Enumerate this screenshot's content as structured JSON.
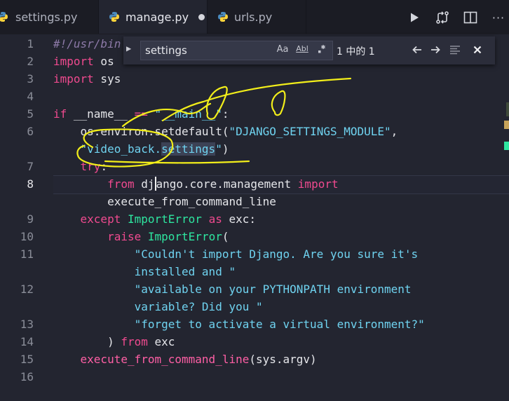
{
  "tabs": [
    {
      "label": "settings.py",
      "active": false,
      "dirty": false
    },
    {
      "label": "manage.py",
      "active": true,
      "dirty": true
    },
    {
      "label": "urls.py",
      "active": false,
      "dirty": false
    }
  ],
  "toolbar": {
    "run_icon": "play-icon",
    "compare_icon": "git-compare-icon",
    "split_icon": "split-editor-icon",
    "more_icon": "more-icon",
    "more_label": "···"
  },
  "find": {
    "value": "settings",
    "placeholder": "",
    "match_case": "Aa",
    "whole_word": "Abl",
    "regex_icon": "regex-icon",
    "match_count": "1 中的 1",
    "prev_icon": "arrow-left-icon",
    "next_icon": "arrow-right-icon",
    "selection_icon": "find-in-selection-icon",
    "close_icon": "close-icon"
  },
  "line_numbers": [
    "1",
    "2",
    "3",
    "4",
    "5",
    "6",
    "",
    "7",
    "8",
    "",
    "9",
    "10",
    "11",
    "",
    "12",
    "",
    "13",
    "14",
    "15",
    "16"
  ],
  "current_line": "8",
  "code": {
    "l1": "#!/usr/bin",
    "l2a": "import",
    "l2b": " os",
    "l3a": "import",
    "l3b": " sys",
    "l5a": "if",
    "l5b": " __name__ ",
    "l5c": "==",
    "l5d": " ",
    "l5e": "\"__main__\"",
    "l5f": ":",
    "l6a": "    os.environ.",
    "l6b": "setdefault",
    "l6c": "(",
    "l6d": "\"DJANGO_SETTINGS_MODULE\"",
    "l6e": ",",
    "l6w1": "    ",
    "l6w2": "\"video_back.",
    "l6w3": "settings",
    "l6w4": "\"",
    "l6w5": ")",
    "l7a": "    ",
    "l7b": "try",
    "l7c": ":",
    "l8a": "        ",
    "l8b": "from",
    "l8c": " dj",
    "l8d": "ango.core.management ",
    "l8e": "import",
    "l8w": "        execute_from_command_line",
    "l9a": "    ",
    "l9b": "except",
    "l9c": " ",
    "l9d": "ImportError",
    "l9e": " ",
    "l9f": "as",
    "l9g": " exc:",
    "l10a": "        ",
    "l10b": "raise",
    "l10c": " ",
    "l10d": "ImportError",
    "l10e": "(",
    "l11a": "            ",
    "l11b": "\"Couldn't import Django. Are you sure it's",
    "l11w": "            installed and \"",
    "l12a": "            ",
    "l12b": "\"available on your PYTHONPATH environment",
    "l12w": "            variable? Did you \"",
    "l13a": "            ",
    "l13b": "\"forget to activate a virtual environment?\"",
    "l14a": "        ) ",
    "l14b": "from",
    "l14c": " exc",
    "l15a": "    ",
    "l15b": "execute_from_command_line",
    "l15c": "(sys.argv)"
  },
  "colors": {
    "background": "#232530",
    "tabbar": "#1b1c24",
    "keyword": "#f04a8f",
    "string": "#6fd3f0",
    "class": "#2ee6a0",
    "annotation": "#f2ee1a"
  }
}
